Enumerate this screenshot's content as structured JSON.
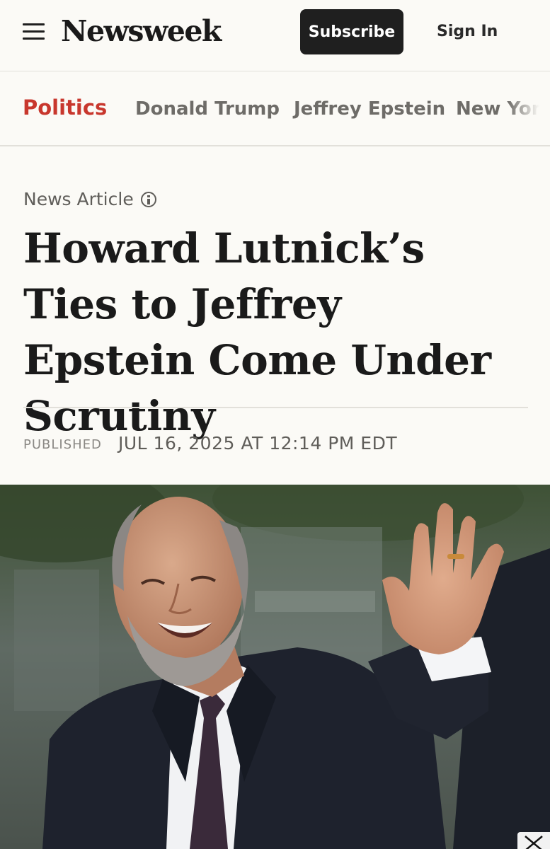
{
  "header": {
    "logo": "Newsweek",
    "subscribe_label": "Subscribe",
    "signin_label": "Sign In"
  },
  "nav": {
    "items": [
      "Politics",
      "Donald Trump",
      "Jeffrey Epstein",
      "New York"
    ]
  },
  "article": {
    "kicker": "News Article",
    "headline": "Howard Lutnick’s Ties to Jeffrey Epstein Come Under Scrutiny",
    "published_label": "PUBLISHED",
    "published_date": "JUL 16, 2025 AT 12:14 PM EDT"
  },
  "icons": {
    "menu": "hamburger-menu-icon",
    "info": "info-circle-icon",
    "close": "close-x-icon"
  },
  "colors": {
    "accent": "#c8372d",
    "button_bg": "#1f1f1f",
    "page_bg": "#fbfaf6"
  }
}
